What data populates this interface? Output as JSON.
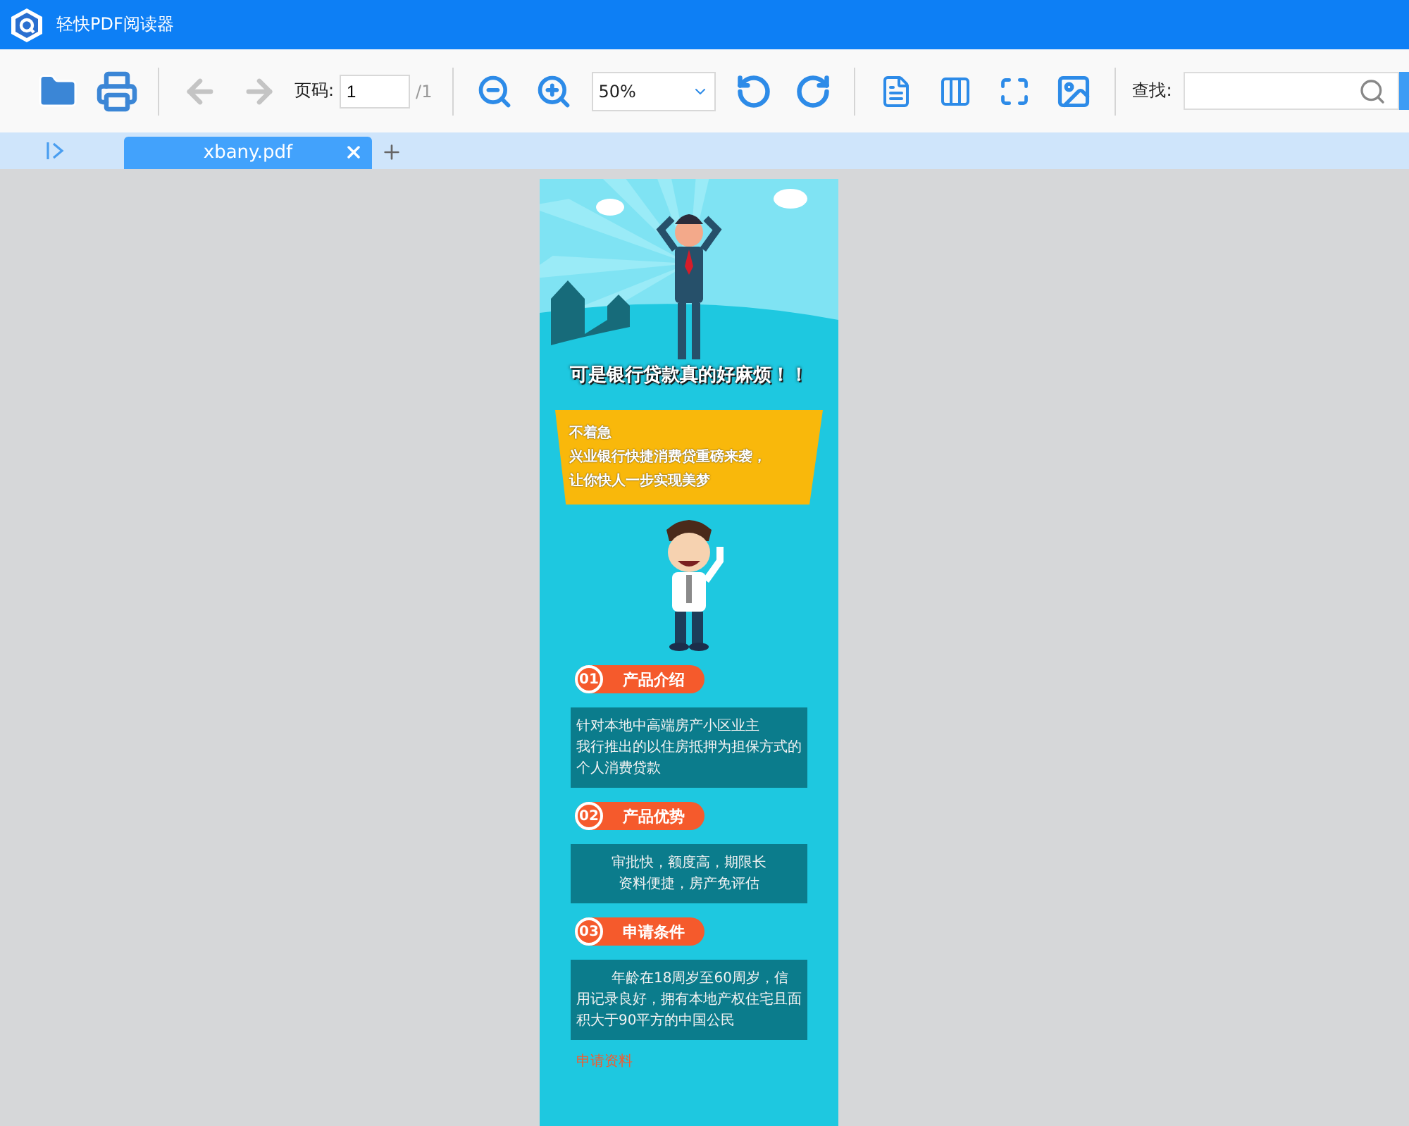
{
  "window": {
    "title": "轻快PDF阅读器"
  },
  "toolbar": {
    "prev_page": {
      "disabled": true
    },
    "next_page": {
      "disabled": true
    },
    "page_label": "页码:",
    "page_value": "1",
    "page_total": "/1",
    "zoom_value": "50%",
    "search_label": "查找:"
  },
  "tabs": [
    {
      "label": "xbany.pdf",
      "selected": true
    }
  ],
  "document": {
    "headline": "可是银行贷款真的好麻烦！！",
    "bubble_lines": [
      "不着急",
      "兴业银行快捷消费贷重磅来袭，",
      "让你快人一步实现美梦"
    ],
    "sections": [
      {
        "number": "01",
        "title": "产品介绍",
        "kind": "list",
        "lines": [
          "针对本地中高端房产小区业主",
          "我行推出的以住房抵押为担保方式的",
          "个人消费贷款"
        ]
      },
      {
        "number": "02",
        "title": "产品优势",
        "kind": "centered",
        "lines": [
          "审批快，额度高，期限长",
          "资料便捷，房产免评估"
        ]
      },
      {
        "number": "03",
        "title": "申请条件",
        "kind": "paragraph",
        "lines": [
          "年龄在18周岁至60周岁，信用记录良好，拥有本地产权住宅且面积大于90平方的中国公民"
        ]
      }
    ],
    "footer_heading": "申请资料"
  }
}
